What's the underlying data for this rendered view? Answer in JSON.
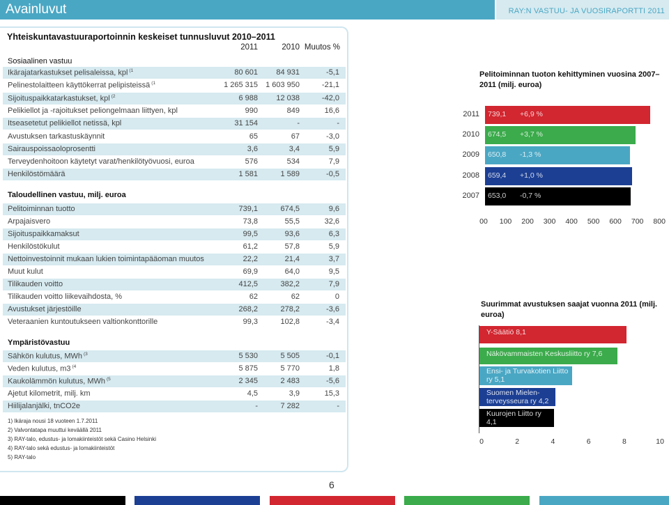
{
  "header": {
    "title": "Avainluvut",
    "report": "RAY:N VASTUU- JA VUOSIRAPORTTI 2011"
  },
  "table": {
    "title": "Yhteiskuntavastuuraportoinnin keskeiset tunnusluvut 2010–2011",
    "columns": [
      "2011",
      "2010",
      "Muutos %"
    ],
    "sections": [
      {
        "name": "Sosiaalinen vastuu",
        "rows": [
          {
            "label": "Ikärajatarkastukset pelisaleissa, kpl",
            "sup": "(1",
            "v2011": "80 601",
            "v2010": "84 931",
            "change": "-5,1"
          },
          {
            "label": "Pelinestolaitteen käyttökerrat pelipisteissä",
            "sup": "(1",
            "v2011": "1 265 315",
            "v2010": "1 603 950",
            "change": "-21,1"
          },
          {
            "label": "Sijoituspaikkatarkastukset, kpl",
            "sup": "(2",
            "v2011": "6 988",
            "v2010": "12 038",
            "change": "-42,0"
          },
          {
            "label": "Pelikiellot ja -rajoitukset peliongelmaan liittyen, kpl",
            "sup": "",
            "v2011": "990",
            "v2010": "849",
            "change": "16,6"
          },
          {
            "label": "Itseasetetut pelikiellot netissä, kpl",
            "sup": "",
            "v2011": "31 154",
            "v2010": "-",
            "change": "-"
          },
          {
            "label": "Avustuksen tarkastuskäynnit",
            "sup": "",
            "v2011": "65",
            "v2010": "67",
            "change": "-3,0"
          },
          {
            "label": "Sairauspoissaoloprosentti",
            "sup": "",
            "v2011": "3,6",
            "v2010": "3,4",
            "change": "5,9"
          },
          {
            "label": "Terveydenhoitoon käytetyt varat/henkilötyövuosi, euroa",
            "sup": "",
            "v2011": "576",
            "v2010": "534",
            "change": "7,9"
          },
          {
            "label": "Henkilöstömäärä",
            "sup": "",
            "v2011": "1 581",
            "v2010": "1 589",
            "change": "-0,5"
          }
        ]
      },
      {
        "name": "Taloudellinen vastuu, milj. euroa",
        "rows": [
          {
            "label": "Pelitoiminnan tuotto",
            "sup": "",
            "v2011": "739,1",
            "v2010": "674,5",
            "change": "9,6"
          },
          {
            "label": "Arpajaisvero",
            "sup": "",
            "v2011": "73,8",
            "v2010": "55,5",
            "change": "32,6"
          },
          {
            "label": "Sijoituspaikkamaksut",
            "sup": "",
            "v2011": "99,5",
            "v2010": "93,6",
            "change": "6,3"
          },
          {
            "label": "Henkilöstökulut",
            "sup": "",
            "v2011": "61,2",
            "v2010": "57,8",
            "change": "5,9"
          },
          {
            "label": "Nettoinvestoinnit mukaan lukien toimintapääoman muutos",
            "sup": "",
            "v2011": "22,2",
            "v2010": "21,4",
            "change": "3,7"
          },
          {
            "label": "Muut kulut",
            "sup": "",
            "v2011": "69,9",
            "v2010": "64,0",
            "change": "9,5"
          },
          {
            "label": "Tilikauden voitto",
            "sup": "",
            "v2011": "412,5",
            "v2010": "382,2",
            "change": "7,9"
          },
          {
            "label": "Tilikauden voitto liikevaihdosta, %",
            "sup": "",
            "v2011": "62",
            "v2010": "62",
            "change": "0"
          },
          {
            "label": "Avustukset järjestöille",
            "sup": "",
            "v2011": "268,2",
            "v2010": "278,2",
            "change": "-3,6"
          },
          {
            "label": "Veteraanien kuntoutukseen valtionkonttorille",
            "sup": "",
            "v2011": "99,3",
            "v2010": "102,8",
            "change": "-3,4"
          }
        ]
      },
      {
        "name": "Ympäristövastuu",
        "rows": [
          {
            "label": "Sähkön kulutus, MWh",
            "sup": "(3",
            "v2011": "5 530",
            "v2010": "5 505",
            "change": "-0,1"
          },
          {
            "label": "Veden kulutus, m3",
            "sup": "(4",
            "v2011": "5 875",
            "v2010": "5 770",
            "change": "1,8"
          },
          {
            "label": "Kaukolämmön kulutus, MWh",
            "sup": "(5",
            "v2011": "2 345",
            "v2010": "2 483",
            "change": "-5,6"
          },
          {
            "label": "Ajetut kilometrit, milj. km",
            "sup": "",
            "v2011": "4,5",
            "v2010": "3,9",
            "change": "15,3"
          },
          {
            "label": "Hiilijalanjälki, tnCO2e",
            "sup": "",
            "v2011": "-",
            "v2010": "7 282",
            "change": "-"
          }
        ]
      }
    ],
    "footnotes": [
      "1) Ikäraja nousi 18 vuoteen 1.7.2011",
      "2) Valvontatapa muuttui keväällä 2011",
      "3) RAY-talo, edustus- ja lomakiinteistöt sekä Casino Helsinki",
      "4) RAY-talo sekä edustus- ja lomakiinteistöt",
      "5) RAY-talo"
    ]
  },
  "chart_data": [
    {
      "type": "bar",
      "title": "Pelitoiminnan tuoton kehittyminen vuosina 2007–2011 (milj. euroa)",
      "categories": [
        "2011",
        "2010",
        "2009",
        "2008",
        "2007"
      ],
      "values": [
        739.1,
        674.5,
        650.8,
        659.4,
        653.0
      ],
      "value_labels": [
        "739,1",
        "674,5",
        "650,8",
        "659,4",
        "653,0"
      ],
      "change_labels": [
        "+6,9 %",
        "+3,7 %",
        "-1,3 %",
        "+1,0 %",
        "-0,7 %"
      ],
      "colors": [
        "#d22630",
        "#3bab4b",
        "#4aa7c4",
        "#1c3f94",
        "#000000"
      ],
      "xlim": [
        0,
        800
      ],
      "ticks": [
        "00",
        "100",
        "200",
        "300",
        "400",
        "500",
        "600",
        "700",
        "800"
      ]
    },
    {
      "type": "bar",
      "title": "Suurimmat avustuksen saajat vuonna 2011 (milj. euroa)",
      "categories": [
        "Y-Säätiö",
        "Näkövammaisten Keskusliitto ry",
        "Ensi- ja Turvakotien Liitto ry",
        "Suomen Mielenterveysseura ry",
        "Kuurojen Liitto ry"
      ],
      "labels": [
        "Y-Säätiö 8,1",
        "Näkövammaisten Keskusliitto ry 7,6",
        "Ensi- ja Turvakotien Liitto ry 5,1",
        "Suomen Mielen-terveysseura ry 4,2",
        "Kuurojen Liitto ry 4,1"
      ],
      "values": [
        8.1,
        7.6,
        5.1,
        4.2,
        4.1
      ],
      "colors": [
        "#d22630",
        "#3bab4b",
        "#4aa7c4",
        "#1c3f94",
        "#000000"
      ],
      "xlim": [
        0,
        10
      ],
      "ticks": [
        "0",
        "2",
        "4",
        "6",
        "8",
        "10"
      ]
    }
  ],
  "page_number": "6",
  "footer_colors": [
    "#000000",
    "#1c3f94",
    "#d22630",
    "#3bab4b",
    "#4aa7c4"
  ]
}
